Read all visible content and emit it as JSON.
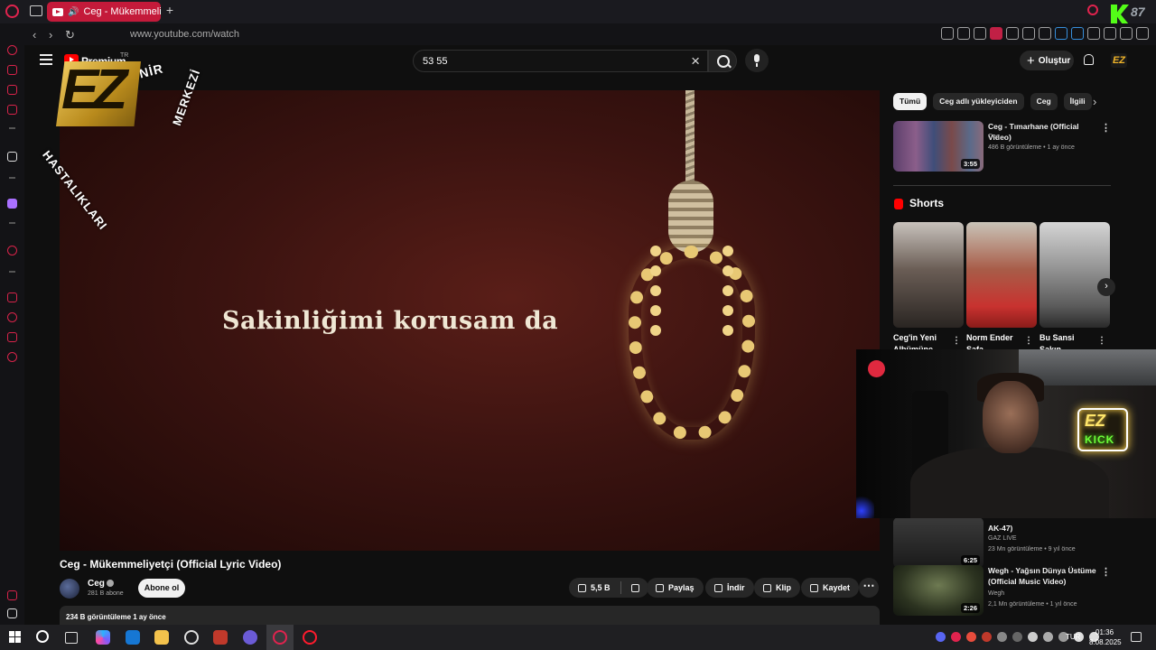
{
  "browser": {
    "tab_title": "Ceg - Mükemmeliyetçi",
    "url": "www.youtube.com/watch",
    "kick_badge": "87"
  },
  "youtube": {
    "logo_text": "Premium",
    "logo_suffix": "TR",
    "search_query": "53 55",
    "create_label": "Oluştur",
    "avatar_text": "EZ"
  },
  "video": {
    "lyric": "Sakinliğimi korusam da",
    "title": "Ceg - Mükemmeliyetçi (Official Lyric Video)",
    "channel": "Ceg",
    "subscribers": "281 B abone",
    "subscribe_label": "Abone ol",
    "likes": "5,5 B",
    "share_label": "Paylaş",
    "download_label": "İndir",
    "clip_label": "Klip",
    "save_label": "Kaydet",
    "description": "234 B görüntüleme  1 ay önce"
  },
  "stream_logo": {
    "top_text": "RUH VE SİNİR",
    "left_text": "HASTALIKLARI",
    "right_text": "MERKEZİ",
    "letters": "EZ"
  },
  "chips": [
    "Tümü",
    "Ceg adlı yükleyiciden",
    "Ceg",
    "İlgili"
  ],
  "related": [
    {
      "title": "Ceg - Tımarhane (Official Video)",
      "channel": "Ceg",
      "meta": "486 B görüntüleme • 1 ay önce",
      "duration": "3:55"
    },
    {
      "title": "AK-47)",
      "channel": "GAZ LIVE",
      "meta": "23 Mn görüntüleme • 9 yıl önce",
      "duration": "6:25"
    },
    {
      "title": "Wegh - Yağsın Dünya Üstüme (Official Music Video)",
      "channel": "Wegh",
      "meta": "2,1 Mn görüntüleme • 1 yıl önce",
      "duration": "2:26"
    }
  ],
  "shorts": {
    "heading": "Shorts",
    "items": [
      {
        "label": "Ceg'in Yeni Albümüne"
      },
      {
        "label": "Norm Ender Safa"
      },
      {
        "label": "Bu Sansi Sakın"
      }
    ]
  },
  "webcam": {
    "neon_top": "EZ",
    "neon_bottom": "KICK"
  },
  "taskbar": {
    "lang": "TUR",
    "time": "01:36",
    "date": "8.08.2025"
  }
}
